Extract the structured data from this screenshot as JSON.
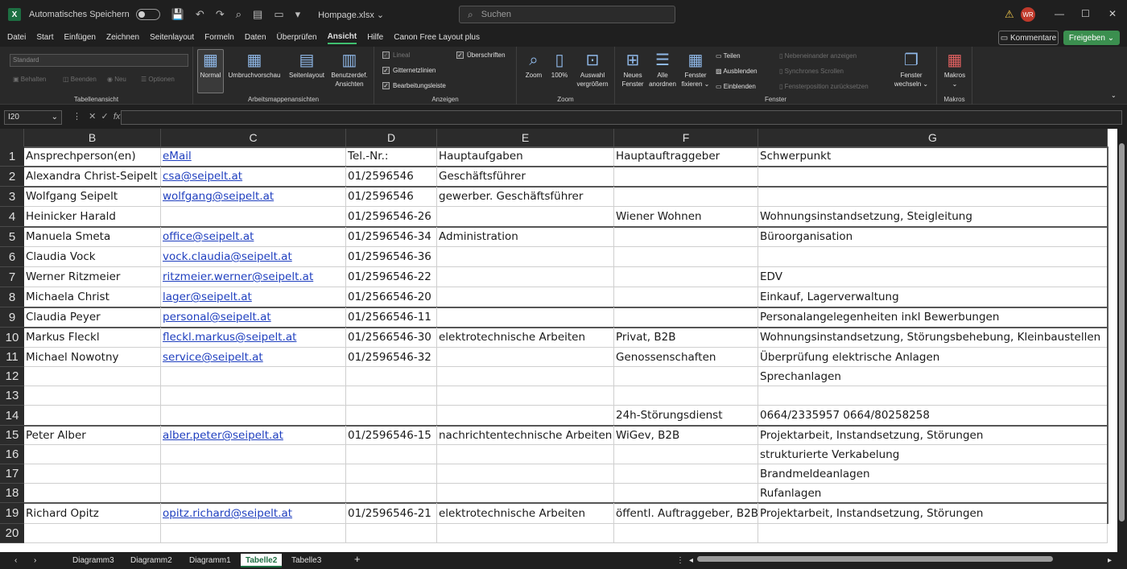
{
  "titlebar": {
    "autosave_label": "Automatisches Speichern",
    "filename": "Hompage.xlsx",
    "search_placeholder": "Suchen",
    "avatar_initials": "WR"
  },
  "menu": {
    "items": [
      "Datei",
      "Start",
      "Einfügen",
      "Zeichnen",
      "Seitenlayout",
      "Formeln",
      "Daten",
      "Überprüfen",
      "Ansicht",
      "Hilfe",
      "Canon Free Layout plus"
    ],
    "active": "Ansicht",
    "comments_label": "Kommentare",
    "share_label": "Freigeben"
  },
  "ribbon": {
    "sheet_view": {
      "style_value": "Standard",
      "items": [
        "Behalten",
        "Beenden",
        "Neu",
        "Optionen"
      ],
      "label": "Tabellenansicht"
    },
    "workbook_views": {
      "items": [
        "Normal",
        "Umbruchvorschau",
        "Seitenlayout",
        "Benutzerdef. Ansichten"
      ],
      "label": "Arbeitsmappenansichten"
    },
    "show": {
      "checks": [
        {
          "label": "Lineal",
          "checked": true,
          "disabled": true
        },
        {
          "label": "Gitternetzlinien",
          "checked": true
        },
        {
          "label": "Bearbeitungsleiste",
          "checked": true
        },
        {
          "label": "Überschriften",
          "checked": true
        }
      ],
      "label": "Anzeigen"
    },
    "zoom": {
      "items": [
        "Zoom",
        "100%",
        "Auswahl vergrößern"
      ],
      "label": "Zoom"
    },
    "window": {
      "items": [
        "Neues Fenster",
        "Alle anordnen",
        "Fenster fixieren",
        "Teilen",
        "Ausblenden",
        "Einblenden",
        "Nebeneinander anzeigen",
        "Synchrones Scrollen",
        "Fensterposition zurücksetzen",
        "Fenster wechseln"
      ],
      "label": "Fenster"
    },
    "macros": {
      "items": [
        "Makros"
      ],
      "label": "Makros"
    }
  },
  "formula_bar": {
    "name_box": "I20",
    "formula": ""
  },
  "columns": [
    {
      "letter": "B"
    },
    {
      "letter": "C"
    },
    {
      "letter": "D"
    },
    {
      "letter": "E"
    },
    {
      "letter": "F"
    },
    {
      "letter": "G"
    }
  ],
  "rows": [
    {
      "n": "1",
      "cells": [
        "Ansprechperson(en)",
        "eMail",
        "Tel.-Nr.:",
        "Hauptaufgaben",
        "Hauptauftraggeber",
        "Schwerpunkt"
      ]
    },
    {
      "n": "2",
      "cells": [
        "Alexandra Christ-Seipelt",
        "csa@seipelt.at",
        "01/2596546",
        "Geschäftsführer",
        "",
        ""
      ]
    },
    {
      "n": "3",
      "cells": [
        "Wolfgang Seipelt",
        "wolfgang@seipelt.at",
        "01/2596546",
        "gewerber. Geschäftsführer",
        "",
        ""
      ]
    },
    {
      "n": "4",
      "cells": [
        "Heinicker Harald",
        "",
        "01/2596546-26",
        "",
        "Wiener Wohnen",
        "Wohnungsinstandsetzung, Steigleitung"
      ]
    },
    {
      "n": "5",
      "cells": [
        "Manuela Smeta",
        "office@seipelt.at",
        "01/2596546-34",
        "Administration",
        "",
        "Büroorganisation"
      ]
    },
    {
      "n": "6",
      "cells": [
        "Claudia Vock",
        "vock.claudia@seipelt.at",
        "01/2596546-36",
        "",
        "",
        ""
      ]
    },
    {
      "n": "7",
      "cells": [
        "Werner Ritzmeier",
        "ritzmeier.werner@seipelt.at",
        "01/2596546-22",
        "",
        "",
        "EDV"
      ]
    },
    {
      "n": "8",
      "cells": [
        "Michaela Christ",
        "lager@seipelt.at",
        "01/2566546-20",
        "",
        "",
        "Einkauf, Lagerverwaltung"
      ]
    },
    {
      "n": "9",
      "cells": [
        "Claudia Peyer",
        "personal@seipelt.at",
        "01/2566546-11",
        "",
        "",
        "Personalangelegenheiten inkl Bewerbungen"
      ]
    },
    {
      "n": "10",
      "cells": [
        "Markus Fleckl",
        "fleckl.markus@seipelt.at",
        "01/2566546-30",
        "elektrotechnische Arbeiten",
        "Privat, B2B",
        "Wohnungsinstandsetzung, Störungsbehebung, Kleinbaustellen"
      ]
    },
    {
      "n": "11",
      "cells": [
        "Michael Nowotny",
        "service@seipelt.at",
        "01/2596546-32",
        "",
        "Genossenschaften",
        "Überprüfung elektrische Anlagen"
      ]
    },
    {
      "n": "12",
      "cells": [
        "",
        "",
        "",
        "",
        "",
        "Sprechanlagen"
      ]
    },
    {
      "n": "13",
      "cells": [
        "",
        "",
        "",
        "",
        "",
        ""
      ]
    },
    {
      "n": "14",
      "cells": [
        "",
        "",
        "",
        "",
        "24h-Störungsdienst",
        "0664/2335957 0664/80258258"
      ]
    },
    {
      "n": "15",
      "cells": [
        "Peter Alber",
        "alber.peter@seipelt.at",
        "01/2596546-15",
        "nachrichtentechnische Arbeiten",
        "WiGev, B2B",
        "Projektarbeit, Instandsetzung, Störungen"
      ]
    },
    {
      "n": "16",
      "cells": [
        "",
        "",
        "",
        "",
        "",
        "strukturierte Verkabelung"
      ]
    },
    {
      "n": "17",
      "cells": [
        "",
        "",
        "",
        "",
        "",
        "Brandmeldeanlagen"
      ]
    },
    {
      "n": "18",
      "cells": [
        "",
        "",
        "",
        "",
        "",
        "Rufanlagen"
      ]
    },
    {
      "n": "19",
      "cells": [
        "Richard Opitz",
        "opitz.richard@seipelt.at",
        "01/2596546-21",
        "elektrotechnische Arbeiten",
        "öffentl. Auftraggeber, B2B",
        "Projektarbeit, Instandsetzung, Störungen"
      ]
    },
    {
      "n": "20",
      "cells": [
        "",
        "",
        "",
        "",
        "",
        ""
      ]
    }
  ],
  "sheet_tabs": [
    "Diagramm3",
    "Diagramm2",
    "Diagramm1",
    "Tabelle2",
    "Tabelle3"
  ],
  "active_sheet": "Tabelle2",
  "accent_color": "#1d6f42",
  "link_color": "#1f3fbf"
}
